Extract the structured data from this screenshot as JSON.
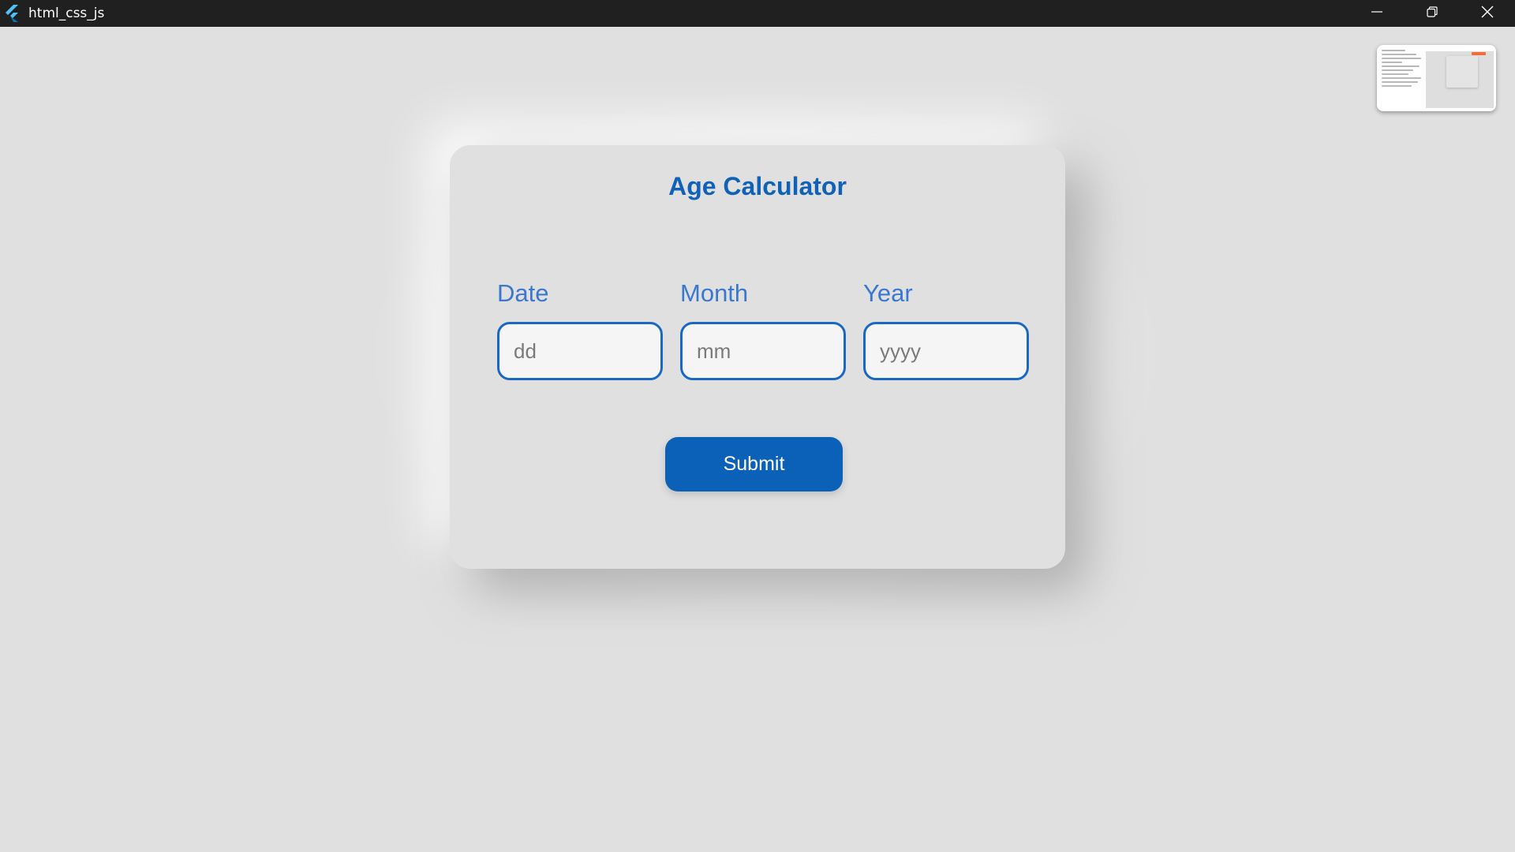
{
  "window": {
    "title": "html_css_js",
    "app_icon": "flutter-icon",
    "controls": [
      "minimize-icon",
      "restore-icon",
      "close-icon"
    ]
  },
  "form": {
    "title": "Age Calculator",
    "fields": [
      {
        "label": "Date",
        "placeholder": "dd"
      },
      {
        "label": "Month",
        "placeholder": "mm"
      },
      {
        "label": "Year",
        "placeholder": "yyyy"
      }
    ],
    "submit_label": "Submit"
  },
  "colors": {
    "accent": "#1161b6",
    "label": "#3a78cf",
    "button": "#0b61b8",
    "background": "#e0e0e0",
    "titlebar": "#202020"
  }
}
